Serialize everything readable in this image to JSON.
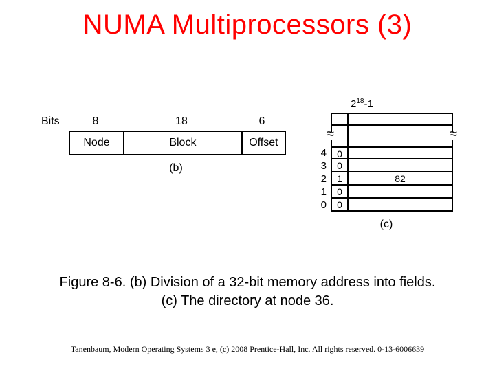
{
  "title": "NUMA Multiprocessors (3)",
  "diagram_b": {
    "bits_label": "Bits",
    "widths": [
      "8",
      "18",
      "6"
    ],
    "fields": [
      "Node",
      "Block",
      "Offset"
    ],
    "sub": "(b)"
  },
  "diagram_c": {
    "top_label_base": "2",
    "top_label_exp": "18",
    "top_label_suffix": "-1",
    "rows": [
      {
        "idx": "4",
        "c1": "0",
        "c2": ""
      },
      {
        "idx": "3",
        "c1": "0",
        "c2": ""
      },
      {
        "idx": "2",
        "c1": "1",
        "c2": "82"
      },
      {
        "idx": "1",
        "c1": "0",
        "c2": ""
      },
      {
        "idx": "0",
        "c1": "0",
        "c2": ""
      }
    ],
    "sub": "(c)"
  },
  "caption_line1": "Figure 8-6. (b) Division of a 32-bit memory address into fields.",
  "caption_line2": "(c) The directory at node 36.",
  "footer": "Tanenbaum, Modern Operating Systems 3 e, (c) 2008 Prentice-Hall, Inc. All rights reserved. 0-13-6006639"
}
